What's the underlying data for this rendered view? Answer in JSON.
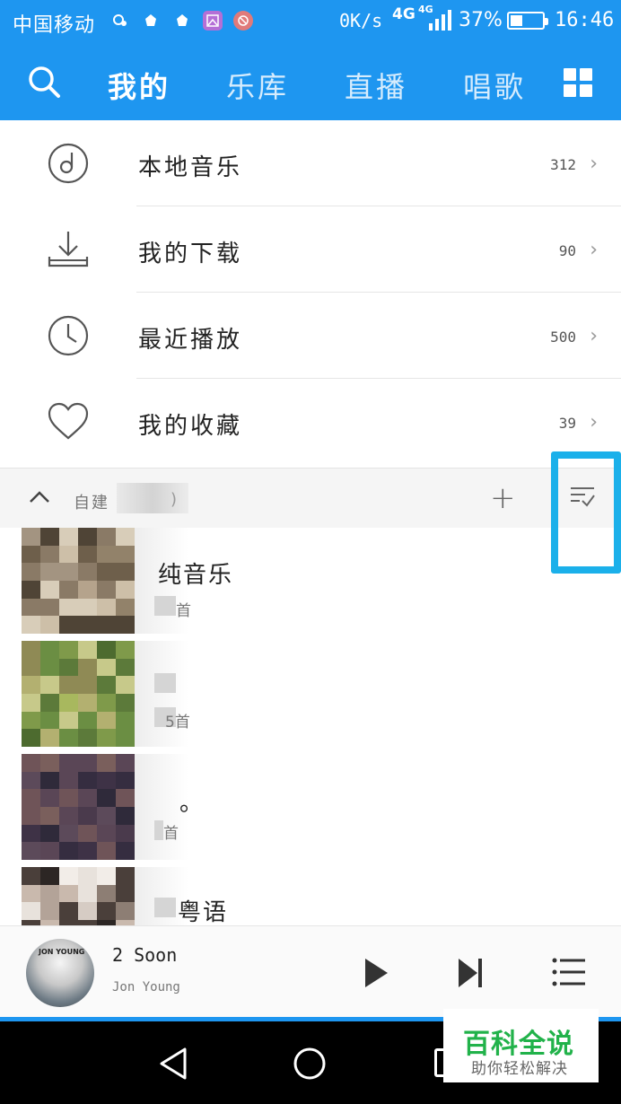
{
  "status_bar": {
    "carrier": "中国移动",
    "net_speed": "0K/s",
    "network_a": "4G",
    "network_b": "4G",
    "battery_percent": "37%",
    "battery_level": 0.37,
    "time": "16:46"
  },
  "top_nav": {
    "tabs": [
      {
        "label": "我的",
        "active": true
      },
      {
        "label": "乐库",
        "active": false
      },
      {
        "label": "直播",
        "active": false
      },
      {
        "label": "唱歌",
        "active": false
      }
    ],
    "accent_color": "#1e96f0"
  },
  "library": [
    {
      "label": "本地音乐",
      "count": "312",
      "icon": "disc-icon"
    },
    {
      "label": "我的下载",
      "count": "90",
      "icon": "download-icon"
    },
    {
      "label": "最近播放",
      "count": "500",
      "icon": "clock-icon"
    },
    {
      "label": "我的收藏",
      "count": "39",
      "icon": "heart-icon"
    }
  ],
  "playlists_section": {
    "title": "自建",
    "title_tail": ")",
    "add_icon": "plus-icon",
    "manage_icon": "sort-check-icon",
    "highlight_color": "#1bb0ea"
  },
  "playlists": [
    {
      "name": "纯音乐",
      "count": "首"
    },
    {
      "name": "",
      "count": "5首"
    },
    {
      "name": "。",
      "count": "首"
    },
    {
      "name": "粤语",
      "count": ""
    }
  ],
  "mini_player": {
    "title": "2 Soon",
    "artist": "Jon Young",
    "cover_text": "JON YOUNG"
  },
  "watermark": {
    "title": "百科全说",
    "subtitle": "助你轻松解决",
    "color": "#21b24a"
  }
}
